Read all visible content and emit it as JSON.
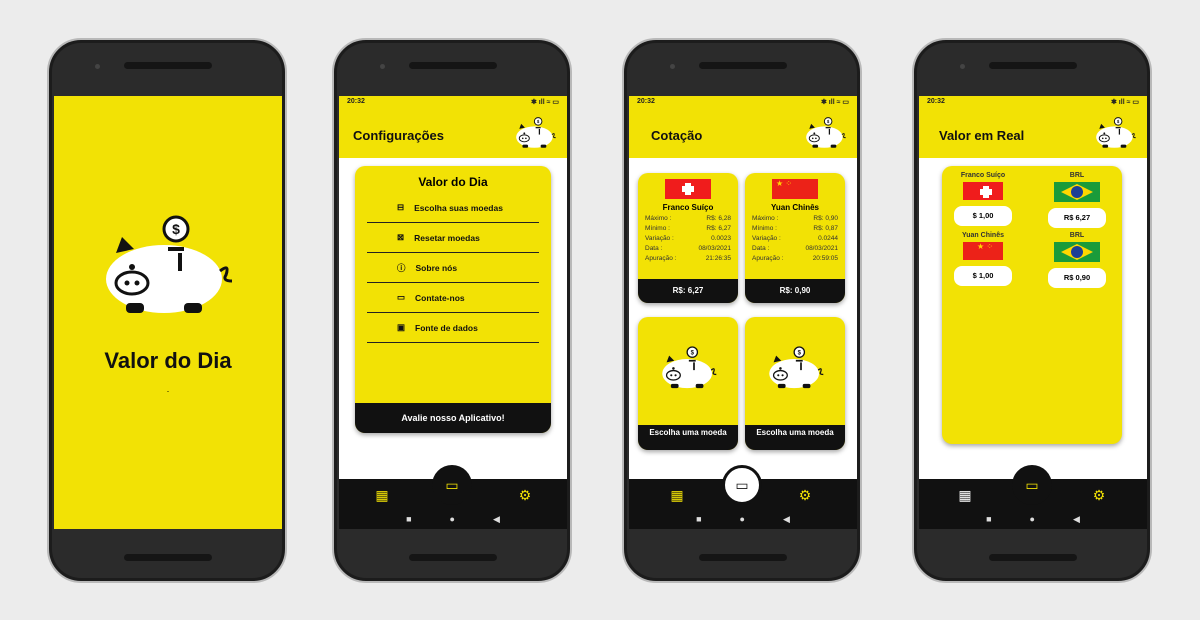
{
  "splash": {
    "title": "Valor do Dia",
    "dot": "."
  },
  "status": {
    "time": "20:32",
    "icons": "✱ ıll ≈ ▭"
  },
  "settings": {
    "header": "Configurações",
    "card_title": "Valor do Dia",
    "items": [
      {
        "label": "Escolha suas moedas",
        "icon": "basket"
      },
      {
        "label": "Resetar moedas",
        "icon": "reset-box"
      },
      {
        "label": "Sobre nós",
        "icon": "info"
      },
      {
        "label": "Contate-nos",
        "icon": "chat"
      },
      {
        "label": "Fonte de dados",
        "icon": "monitor"
      }
    ],
    "rate_button": "Avalie nosso Aplicativo!"
  },
  "quote": {
    "header": "Cotação",
    "cards": [
      {
        "name": "Franco Suíço",
        "max_label": "Máximo :",
        "max": "R$: 6,28",
        "min_label": "Mínimo :",
        "min": "R$: 6,27",
        "var_label": "Variação :",
        "var": "0.0023",
        "date_label": "Data :",
        "date": "08/03/2021",
        "time_label": "Apuração :",
        "time": "21:26:35",
        "footer": "R$: 6,27"
      },
      {
        "name": "Yuan Chinês",
        "max_label": "Máximo :",
        "max": "R$: 0,90",
        "min_label": "Mínimo :",
        "min": "R$: 0,87",
        "var_label": "Variação :",
        "var": "0.0244",
        "date_label": "Data :",
        "date": "08/03/2021",
        "time_label": "Apuração :",
        "time": "20:59:05",
        "footer": "R$: 0,90"
      }
    ],
    "empty_label": "Escolha uma moeda"
  },
  "convert": {
    "header": "Valor em Real",
    "rows": [
      {
        "from": "Franco Suíço",
        "from_value": "$ 1,00",
        "to": "BRL",
        "to_value": "R$ 6,27"
      },
      {
        "from": "Yuan Chinês",
        "from_value": "$ 1,00",
        "to": "BRL",
        "to_value": "R$ 0,90"
      }
    ]
  },
  "nav": {
    "calc": "▦",
    "money": "▭",
    "gear": "⚙",
    "back": "◀",
    "home": "●",
    "recents": "■"
  },
  "colors": {
    "yellow": "#f2e205",
    "black": "#111111"
  }
}
